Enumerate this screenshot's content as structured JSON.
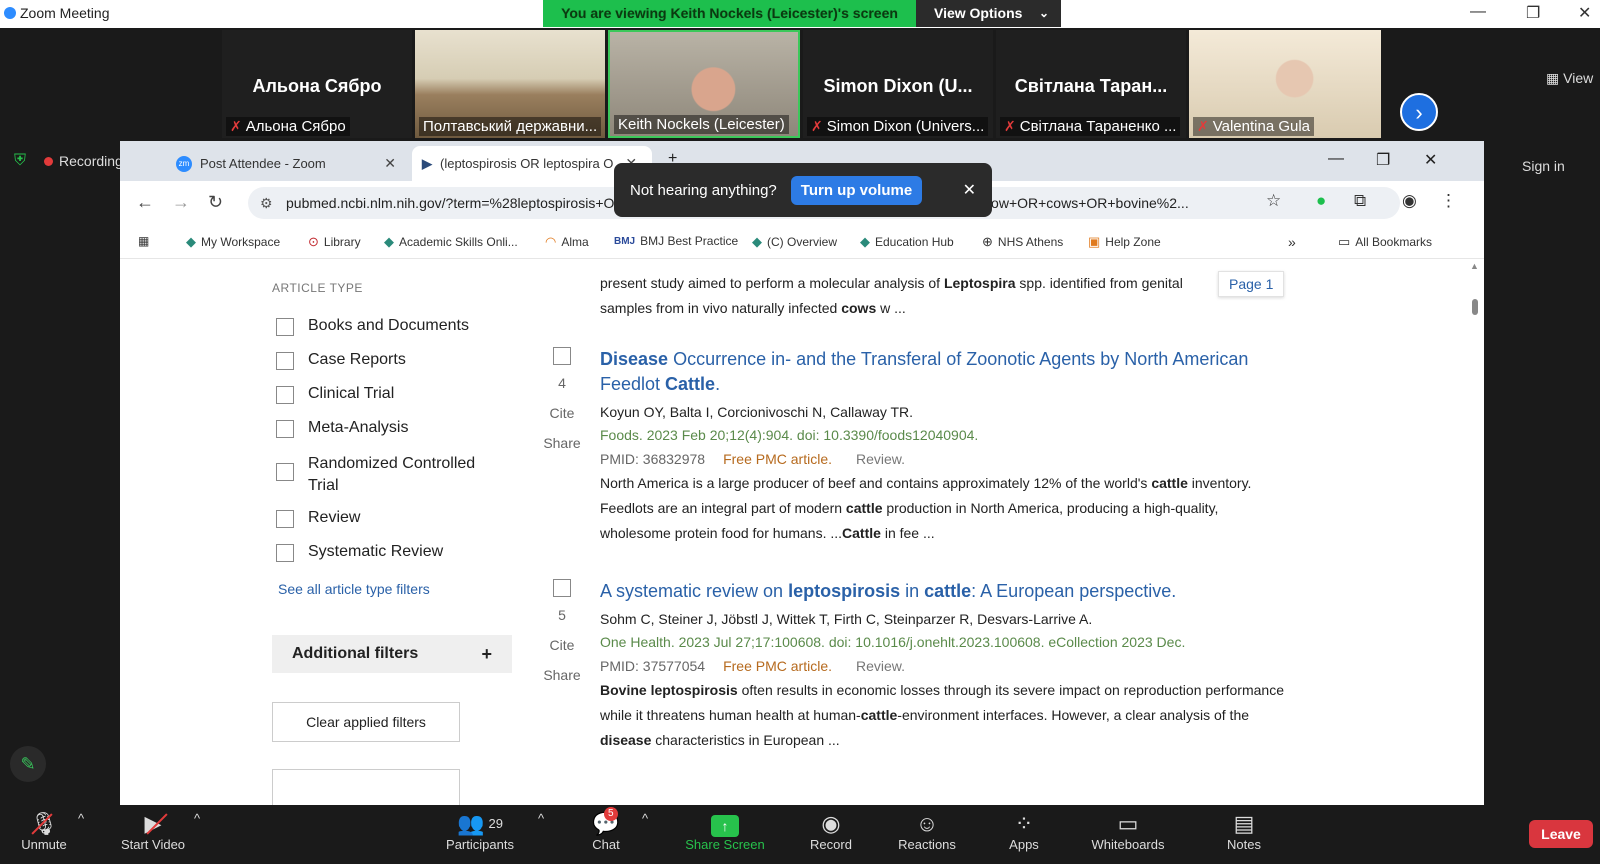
{
  "zoom": {
    "window_title": "Zoom Meeting",
    "banner_text": "You are viewing Keith Nockels (Leicester)'s screen",
    "view_options": "View Options",
    "view_label": "View",
    "recording_label": "Recording",
    "sign_in": "Sign in"
  },
  "participants": [
    {
      "big_name": "Альона Сябро",
      "tag": "Альона Сябро"
    },
    {
      "big_name": "",
      "tag": "Полтавський державни..."
    },
    {
      "big_name": "",
      "tag": "Keith Nockels (Leicester)"
    },
    {
      "big_name": "Simon Dixon (U...",
      "tag": "Simon Dixon (Univers..."
    },
    {
      "big_name": "Світлана Таран...",
      "tag": "Світлана Тараненко ..."
    },
    {
      "big_name": "",
      "tag": "Valentina Gula"
    }
  ],
  "browser": {
    "tabs": [
      {
        "label": "Post Attendee - Zoom",
        "favicon": "zm"
      },
      {
        "label": "(leptospirosis OR leptospira O"
      }
    ],
    "url": "pubmed.ncbi.nlm.nih.gov/?term=%28leptospirosis+OR+leptospira+OR+weil+disease%29+AND+%28cattle+OR+cow+OR+cows+OR+bovine%2...",
    "bookmarks": [
      "My Workspace",
      "Library",
      "Academic Skills Onli...",
      "Alma",
      "BMJ Best Practice",
      "(C) Overview",
      "Education Hub",
      "NHS Athens",
      "Help Zone"
    ],
    "all_bookmarks": "All Bookmarks",
    "overflow": "»"
  },
  "toast": {
    "message": "Not hearing anything?",
    "button": "Turn up volume"
  },
  "filters": {
    "header": "ARTICLE TYPE",
    "items": [
      "Books and Documents",
      "Case Reports",
      "Clinical Trial",
      "Meta-Analysis",
      "Randomized Controlled Trial",
      "Review",
      "Systematic Review"
    ],
    "see_all": "See all article type filters",
    "additional": "Additional filters",
    "clear": "Clear applied filters"
  },
  "page_indicator": "Page 1",
  "top_snippet": {
    "line1_pre": "present study aimed to perform a molecular analysis of ",
    "line1_bold": "Leptospira",
    "line1_post": " spp. identified from genital",
    "line2_pre": "samples from in vivo naturally infected ",
    "line2_bold": "cows",
    "line2_post": " w ..."
  },
  "results": [
    {
      "number": "4",
      "cite": "Cite",
      "share": "Share",
      "title_bold1": "Disease",
      "title_mid": " Occurrence in- and the Transferal of Zoonotic Agents by North American Feedlot ",
      "title_bold2": "Cattle",
      "title_end": ".",
      "authors": "Koyun OY, Balta I, Corcionivoschi N, Callaway TR.",
      "journal": "Foods. 2023 Feb 20;12(4):904. doi: 10.3390/foods12040904.",
      "pmid": "PMID: 36832978",
      "pmc": "Free PMC article.",
      "type": "Review.",
      "snippet_html": "North America is a large producer of beef and contains approximately 12% of the world's <b>cattle</b> inventory. Feedlots are an integral part of modern <b>cattle</b> production in North America, producing a high-quality, wholesome protein food for humans. ...<b>Cattle</b> in fee ..."
    },
    {
      "number": "5",
      "cite": "Cite",
      "share": "Share",
      "title_pre": "A systematic review on ",
      "title_bold1": "leptospirosis",
      "title_mid": " in ",
      "title_bold2": "cattle",
      "title_end": ": A European perspective.",
      "authors": "Sohm C, Steiner J, Jöbstl J, Wittek T, Firth C, Steinparzer R, Desvars-Larrive A.",
      "journal": "One Health. 2023 Jul 27;17:100608. doi: 10.1016/j.onehlt.2023.100608. eCollection 2023 Dec.",
      "pmid": "PMID: 37577054",
      "pmc": "Free PMC article.",
      "type": "Review.",
      "snippet_html": "<b>Bovine leptospirosis</b> often results in economic losses through its severe impact on reproduction performance while it threatens human health at human-<b>cattle</b>-environment interfaces. However, a clear analysis of the <b>disease</b> characteristics in European ..."
    }
  ],
  "controls": {
    "unmute": "Unmute",
    "start_video": "Start Video",
    "participants": "Participants",
    "participant_count": "29",
    "chat": "Chat",
    "chat_badge": "5",
    "share_screen": "Share Screen",
    "record": "Record",
    "reactions": "Reactions",
    "apps": "Apps",
    "whiteboards": "Whiteboards",
    "notes": "Notes",
    "leave": "Leave"
  },
  "colors": {
    "zoom_green": "#1dbf4d",
    "link_blue": "#2a61a8",
    "leave_red": "#d9363e"
  }
}
